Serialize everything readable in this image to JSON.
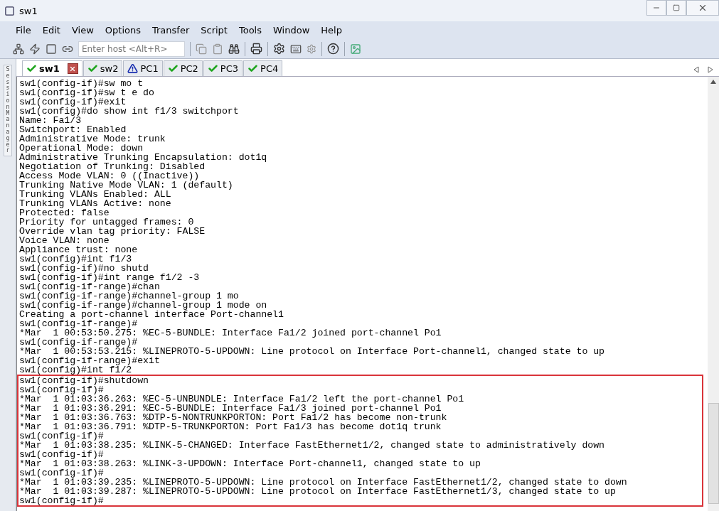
{
  "window": {
    "title": "sw1"
  },
  "menu": [
    "File",
    "Edit",
    "View",
    "Options",
    "Transfer",
    "Script",
    "Tools",
    "Window",
    "Help"
  ],
  "toolbar": {
    "host_field": {
      "placeholder": "Enter host <Alt+R>"
    }
  },
  "session_manager": {
    "label": "Session Manager"
  },
  "tabs": [
    {
      "label": "sw1",
      "kind": "ok",
      "selected": true
    },
    {
      "label": "sw2",
      "kind": "ok",
      "selected": false
    },
    {
      "label": "PC1",
      "kind": "warning",
      "selected": false
    },
    {
      "label": "PC2",
      "kind": "ok",
      "selected": false
    },
    {
      "label": "PC3",
      "kind": "ok",
      "selected": false
    },
    {
      "label": "PC4",
      "kind": "ok",
      "selected": false
    }
  ],
  "terminal": {
    "lines": [
      "sw1(config-if)#sw mo t",
      "sw1(config-if)#sw t e do",
      "sw1(config-if)#exit",
      "sw1(config)#do show int f1/3 switchport",
      "Name: Fa1/3",
      "Switchport: Enabled",
      "Administrative Mode: trunk",
      "Operational Mode: down",
      "Administrative Trunking Encapsulation: dot1q",
      "Negotiation of Trunking: Disabled",
      "Access Mode VLAN: 0 ((Inactive))",
      "Trunking Native Mode VLAN: 1 (default)",
      "Trunking VLANs Enabled: ALL",
      "Trunking VLANs Active: none",
      "Protected: false",
      "Priority for untagged frames: 0",
      "Override vlan tag priority: FALSE",
      "Voice VLAN: none",
      "Appliance trust: none",
      "sw1(config)#int f1/3",
      "sw1(config-if)#no shutd",
      "sw1(config-if)#int range f1/2 -3",
      "sw1(config-if-range)#chan",
      "sw1(config-if-range)#channel-group 1 mo",
      "sw1(config-if-range)#channel-group 1 mode on",
      "Creating a port-channel interface Port-channel1",
      "sw1(config-if-range)#",
      "*Mar  1 00:53:50.275: %EC-5-BUNDLE: Interface Fa1/2 joined port-channel Po1",
      "sw1(config-if-range)#",
      "*Mar  1 00:53:53.215: %LINEPROTO-5-UPDOWN: Line protocol on Interface Port-channel1, changed state to up",
      "sw1(config-if-range)#exit",
      "sw1(config)#int f1/2"
    ],
    "highlighted_block": {
      "lines": [
        "sw1(config-if)#shutdown",
        "sw1(config-if)#",
        "*Mar  1 01:03:36.263: %EC-5-UNBUNDLE: Interface Fa1/2 left the port-channel Po1",
        "*Mar  1 01:03:36.291: %EC-5-BUNDLE: Interface Fa1/3 joined port-channel Po1",
        "*Mar  1 01:03:36.763: %DTP-5-NONTRUNKPORTON: Port Fa1/2 has become non-trunk",
        "*Mar  1 01:03:36.791: %DTP-5-TRUNKPORTON: Port Fa1/3 has become dot1q trunk",
        "sw1(config-if)#",
        "*Mar  1 01:03:38.235: %LINK-5-CHANGED: Interface FastEthernet1/2, changed state to administratively down",
        "sw1(config-if)#",
        "*Mar  1 01:03:38.263: %LINK-3-UPDOWN: Interface Port-channel1, changed state to up",
        "sw1(config-if)#",
        "*Mar  1 01:03:39.235: %LINEPROTO-5-UPDOWN: Line protocol on Interface FastEthernet1/2, changed state to down",
        "*Mar  1 01:03:39.287: %LINEPROTO-5-UPDOWN: Line protocol on Interface FastEthernet1/3, changed state to up",
        "sw1(config-if)#"
      ]
    }
  }
}
